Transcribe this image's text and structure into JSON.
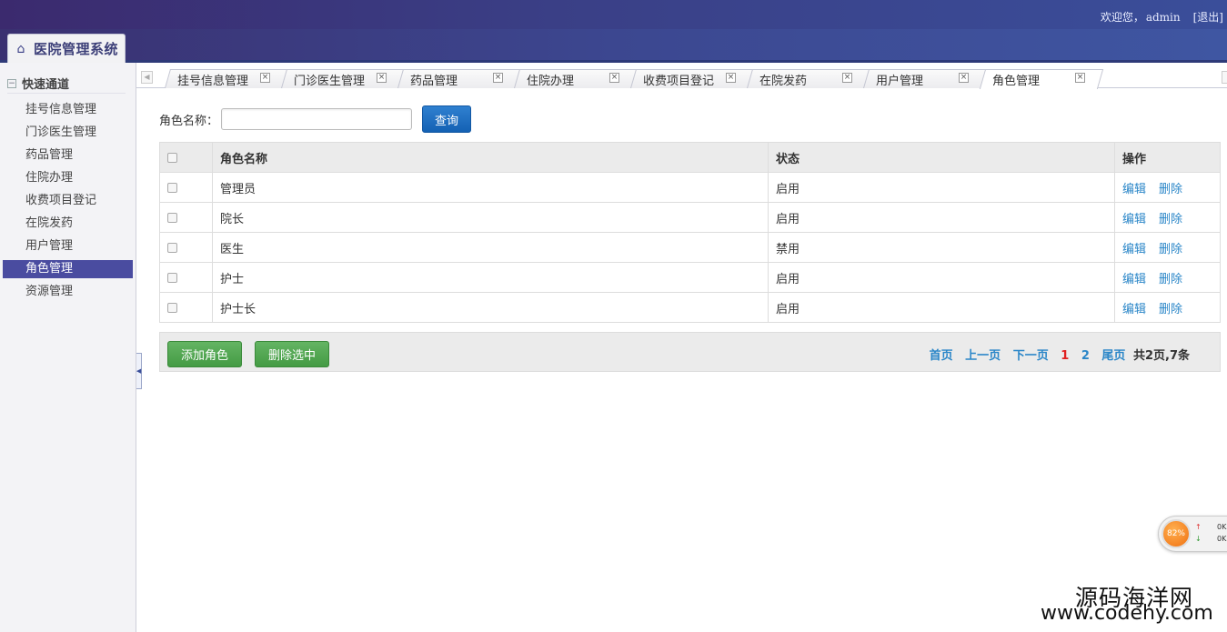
{
  "header": {
    "welcome_text": "欢迎您，",
    "username": "admin",
    "logout_label": "[退出]",
    "app_title": "医院管理系统"
  },
  "sidebar": {
    "section_title": "快速通道",
    "items": [
      {
        "label": "挂号信息管理"
      },
      {
        "label": "门诊医生管理"
      },
      {
        "label": "药品管理"
      },
      {
        "label": "住院办理"
      },
      {
        "label": "收费项目登记"
      },
      {
        "label": "在院发药"
      },
      {
        "label": "用户管理"
      },
      {
        "label": "角色管理",
        "active": true
      },
      {
        "label": "资源管理"
      }
    ]
  },
  "tabs": [
    {
      "label": "挂号信息管理"
    },
    {
      "label": "门诊医生管理"
    },
    {
      "label": "药品管理"
    },
    {
      "label": "住院办理"
    },
    {
      "label": "收费项目登记"
    },
    {
      "label": "在院发药"
    },
    {
      "label": "用户管理"
    },
    {
      "label": "角色管理",
      "active": true
    }
  ],
  "search": {
    "label": "角色名称：",
    "value": "",
    "button_label": "查询"
  },
  "table": {
    "columns": [
      "角色名称",
      "状态",
      "操作"
    ],
    "rows": [
      {
        "name": "管理员",
        "status": "启用"
      },
      {
        "name": "院长",
        "status": "启用"
      },
      {
        "name": "医生",
        "status": "禁用"
      },
      {
        "name": "护士",
        "status": "启用"
      },
      {
        "name": "护士长",
        "status": "启用"
      }
    ],
    "edit_label": "编辑",
    "delete_label": "删除"
  },
  "footer": {
    "add_label": "添加角色",
    "delete_selected_label": "删除选中",
    "pager": {
      "first": "首页",
      "prev": "上一页",
      "next": "下一页",
      "pages": [
        "1",
        "2"
      ],
      "current": "1",
      "last": "尾页",
      "total": "共2页,7条"
    }
  },
  "speed_widget": {
    "percent": "82%",
    "up": "0K",
    "down": "0K"
  },
  "watermark": {
    "cn": "源码海洋网",
    "en": "www.codehy.com"
  },
  "colors": {
    "accent": "#4a4ca0",
    "header": "#3a3f86",
    "link": "#2a86c8",
    "primary_btn": "#1461b4",
    "success_btn": "#449b44",
    "current_page": "#e02020"
  }
}
